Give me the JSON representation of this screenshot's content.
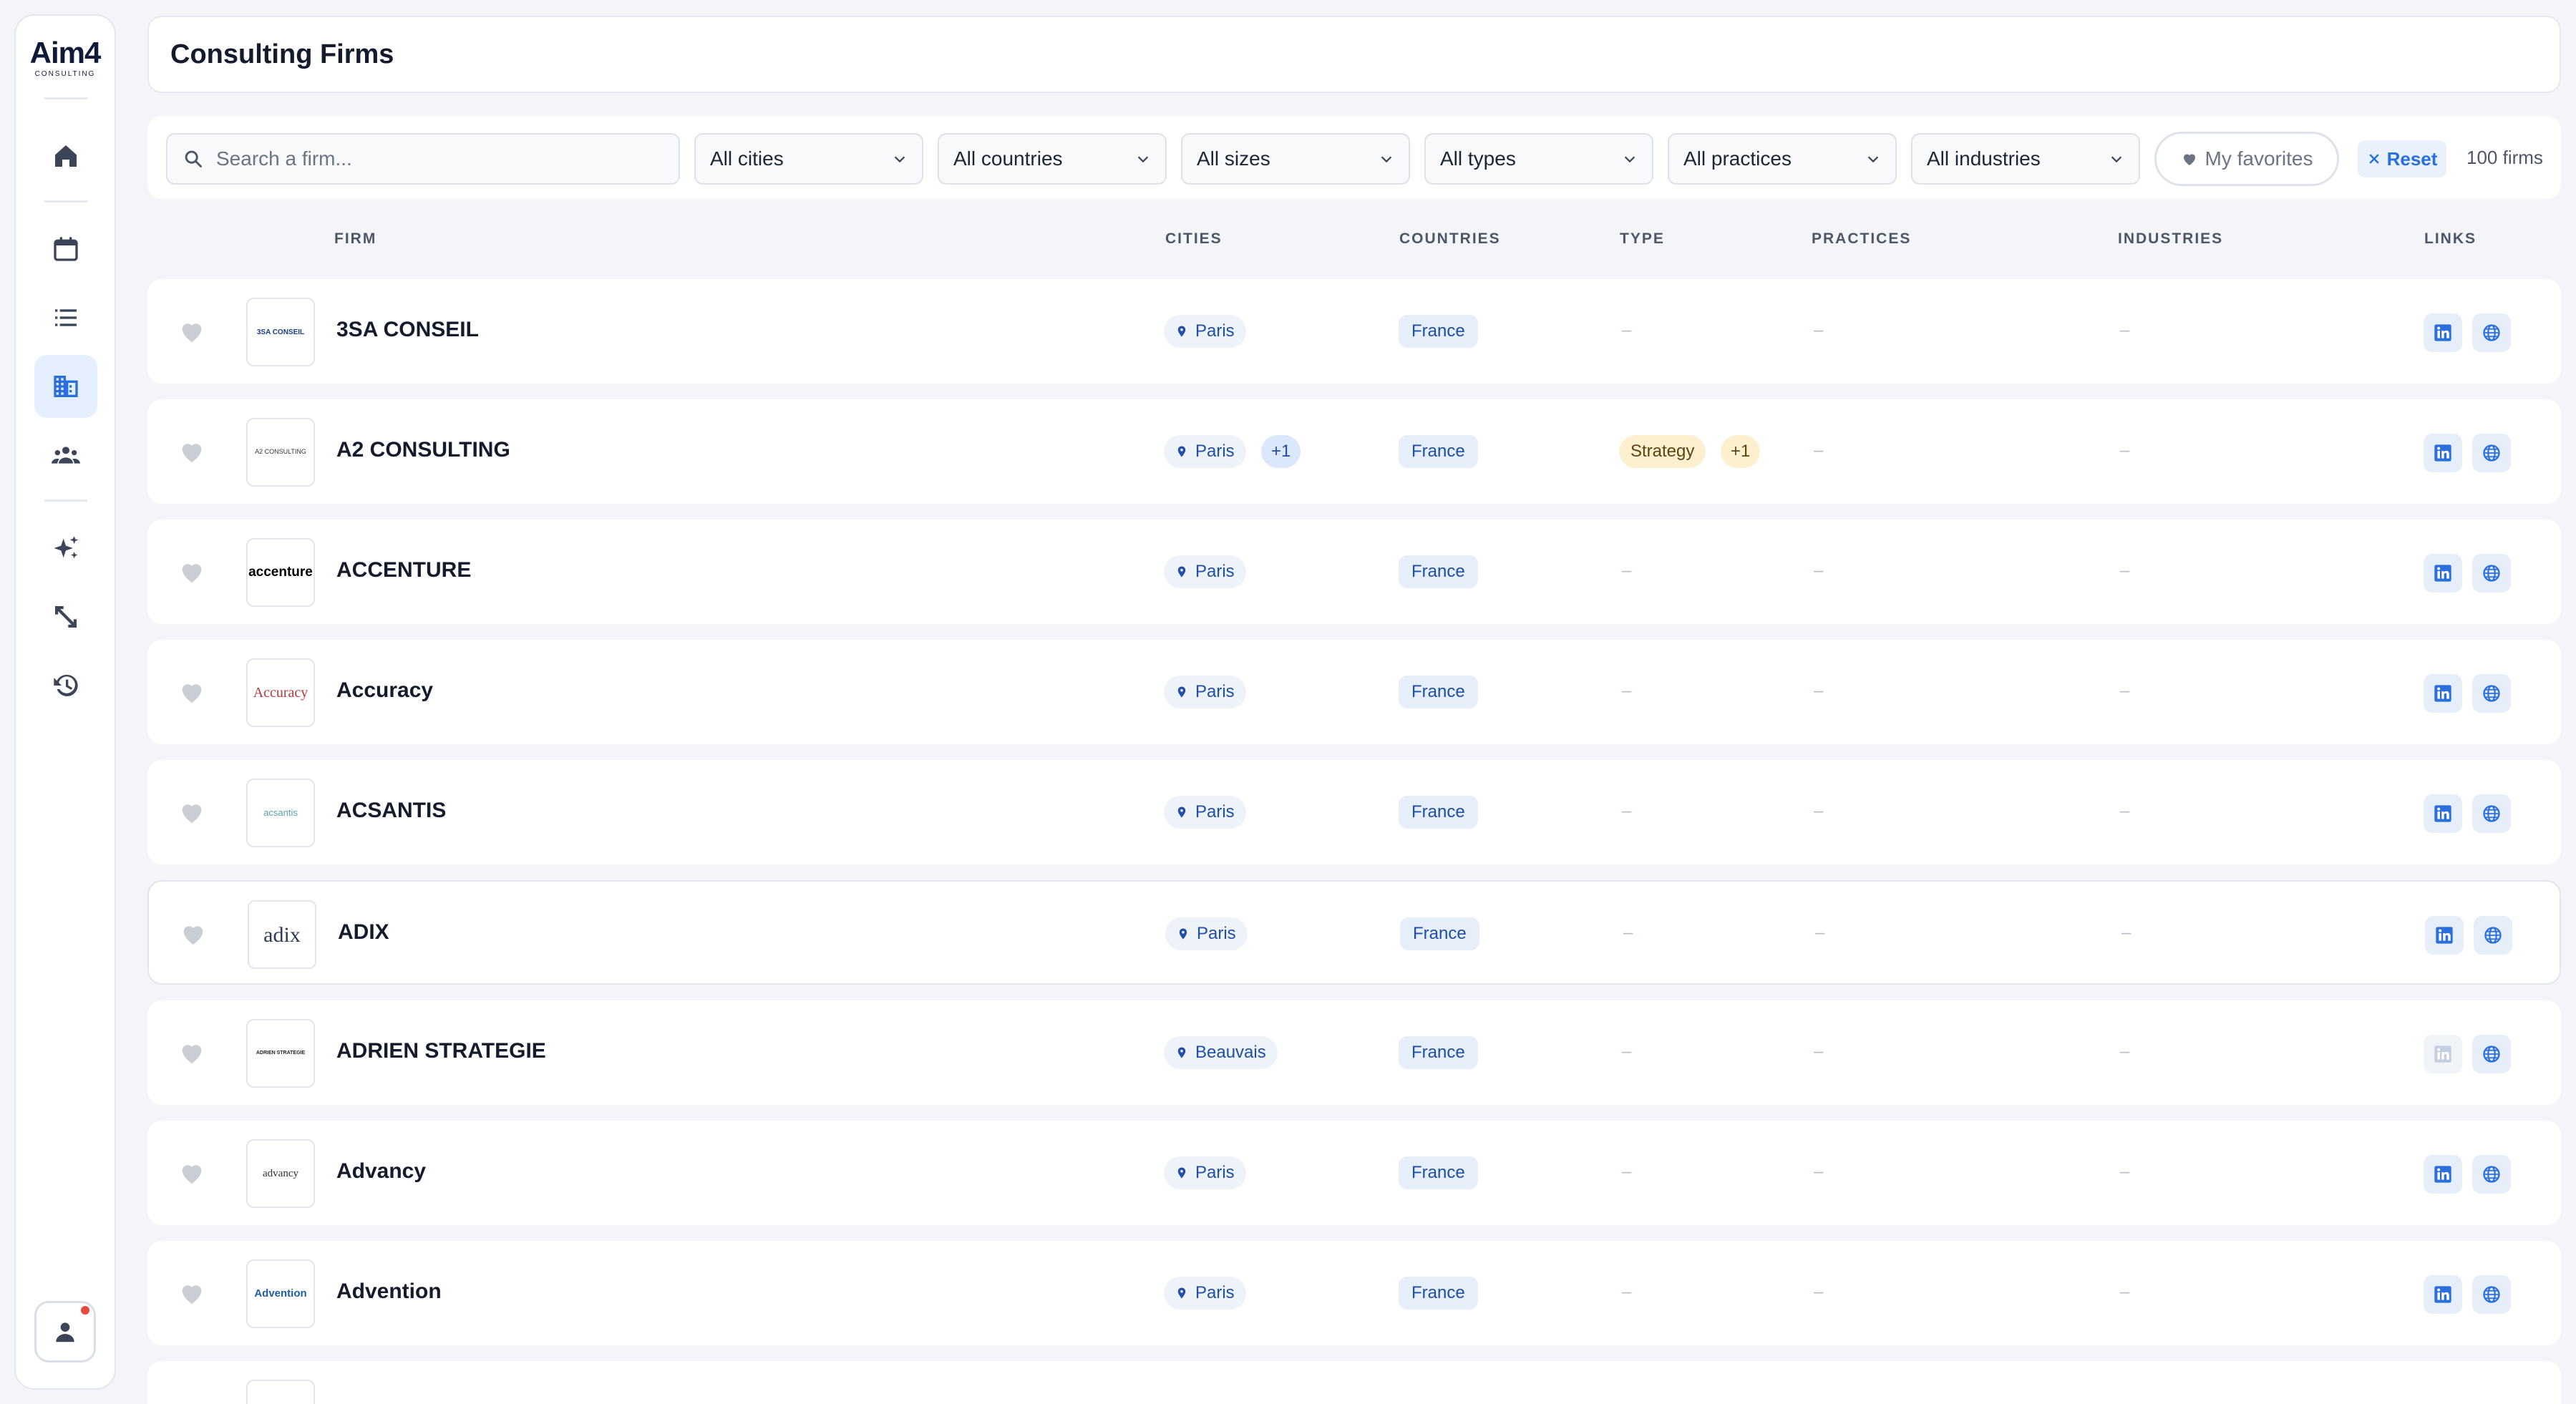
{
  "app": {
    "logo_text": "Aim4",
    "logo_sub": "CONSULTING"
  },
  "header": {
    "title": "Consulting Firms"
  },
  "filters": {
    "search_placeholder": "Search a firm...",
    "selects": [
      "All cities",
      "All countries",
      "All sizes",
      "All types",
      "All practices",
      "All industries"
    ],
    "favorites_label": "My favorites",
    "reset_label": "Reset",
    "count_text": "100 firms"
  },
  "columns": {
    "firm": "FIRM",
    "cities": "CITIES",
    "countries": "COUNTRIES",
    "type": "TYPE",
    "practices": "PRACTICES",
    "industries": "INDUSTRIES",
    "links": "LINKS"
  },
  "placeholder_dash": "–",
  "firms": [
    {
      "name": "3SA CONSEIL",
      "logo_text": "3SA CONSEIL",
      "city": "Paris",
      "city_extra": "",
      "country": "France",
      "type": "",
      "type_extra": "",
      "linkedin": true
    },
    {
      "name": "A2 CONSULTING",
      "logo_text": "A2 CONSULTING",
      "city": "Paris",
      "city_extra": "+1",
      "country": "France",
      "type": "Strategy",
      "type_extra": "+1",
      "linkedin": true
    },
    {
      "name": "ACCENTURE",
      "logo_text": "accenture",
      "city": "Paris",
      "city_extra": "",
      "country": "France",
      "type": "",
      "type_extra": "",
      "linkedin": true
    },
    {
      "name": "Accuracy",
      "logo_text": "Accuracy",
      "city": "Paris",
      "city_extra": "",
      "country": "France",
      "type": "",
      "type_extra": "",
      "linkedin": true
    },
    {
      "name": "ACSANTIS",
      "logo_text": "acsantis",
      "city": "Paris",
      "city_extra": "",
      "country": "France",
      "type": "",
      "type_extra": "",
      "linkedin": true
    },
    {
      "name": "ADIX",
      "logo_text": "adix",
      "city": "Paris",
      "city_extra": "",
      "country": "France",
      "type": "",
      "type_extra": "",
      "linkedin": true
    },
    {
      "name": "ADRIEN STRATEGIE",
      "logo_text": "ADRIEN STRATEGIE",
      "city": "Beauvais",
      "city_extra": "",
      "country": "France",
      "type": "",
      "type_extra": "",
      "linkedin": false
    },
    {
      "name": "Advancy",
      "logo_text": "advancy",
      "city": "Paris",
      "city_extra": "",
      "country": "France",
      "type": "",
      "type_extra": "",
      "linkedin": true
    },
    {
      "name": "Advention",
      "logo_text": "Advention",
      "city": "Paris",
      "city_extra": "",
      "country": "France",
      "type": "",
      "type_extra": "",
      "linkedin": true
    }
  ],
  "colors": {
    "accent": "#2a6fdb",
    "chip_blue_text": "#1e4ea8",
    "type_chip_bg": "#fdf0cf",
    "notification": "#e74a3b"
  },
  "icons": {
    "nav": [
      "home-icon",
      "calendar-icon",
      "list-icon",
      "building-icon",
      "users-icon",
      "sparkles-icon",
      "resize-icon",
      "history-icon"
    ],
    "user": "user-icon"
  }
}
